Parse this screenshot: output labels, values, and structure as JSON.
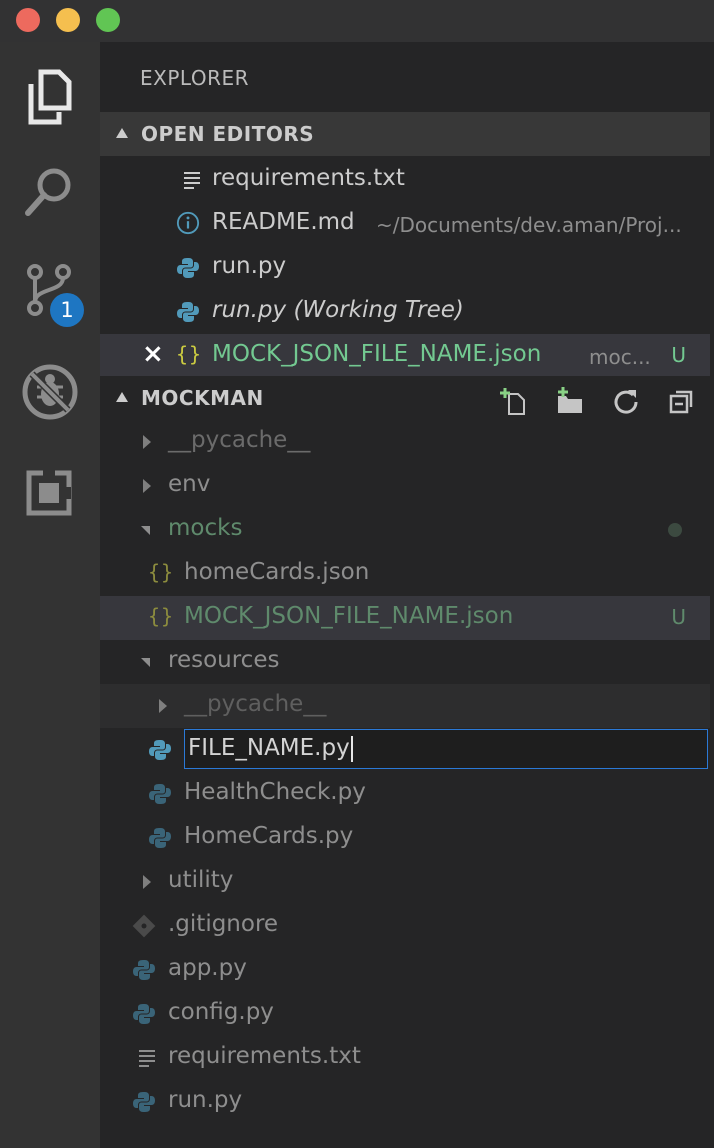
{
  "colors": {
    "green_modified": "#73c991",
    "muted": "#8e8e8e",
    "ignored": "#6b6b6b",
    "badge": "#1e76c2",
    "json_icon": "#cbcb41",
    "python_icon": "#519aba"
  },
  "activity_bar": {
    "items": [
      "files-icon",
      "search-icon",
      "source-control-icon",
      "debug-icon",
      "extensions-icon"
    ],
    "scm_badge": "1"
  },
  "explorer": {
    "title": "EXPLORER",
    "open_editors": {
      "header": "OPEN EDITORS",
      "items": [
        {
          "name": "requirements.txt",
          "icon": "text-file-icon"
        },
        {
          "name": "README.md",
          "icon": "info-icon",
          "path": "~/Documents/dev.aman/Proj..."
        },
        {
          "name": "run.py",
          "icon": "python-icon"
        },
        {
          "name": "run.py (Working Tree)",
          "icon": "python-icon"
        },
        {
          "name": "MOCK_JSON_FILE_NAME.json",
          "icon": "json-icon",
          "path": "moc...",
          "status": "U",
          "close": "×"
        }
      ]
    },
    "project": {
      "header": "MOCKMAN",
      "tree": [
        {
          "name": "__pycache__"
        },
        {
          "name": "env"
        },
        {
          "name": "mocks"
        },
        {
          "name": "homeCards.json"
        },
        {
          "name": "MOCK_JSON_FILE_NAME.json",
          "status": "U"
        },
        {
          "name": "resources"
        },
        {
          "name": "__pycache__"
        },
        {
          "name": "FILE_NAME.py"
        },
        {
          "name": "HealthCheck.py"
        },
        {
          "name": "HomeCards.py"
        },
        {
          "name": "utility"
        },
        {
          "name": ".gitignore"
        },
        {
          "name": "app.py"
        },
        {
          "name": "config.py"
        },
        {
          "name": "requirements.txt"
        },
        {
          "name": "run.py"
        }
      ]
    }
  }
}
